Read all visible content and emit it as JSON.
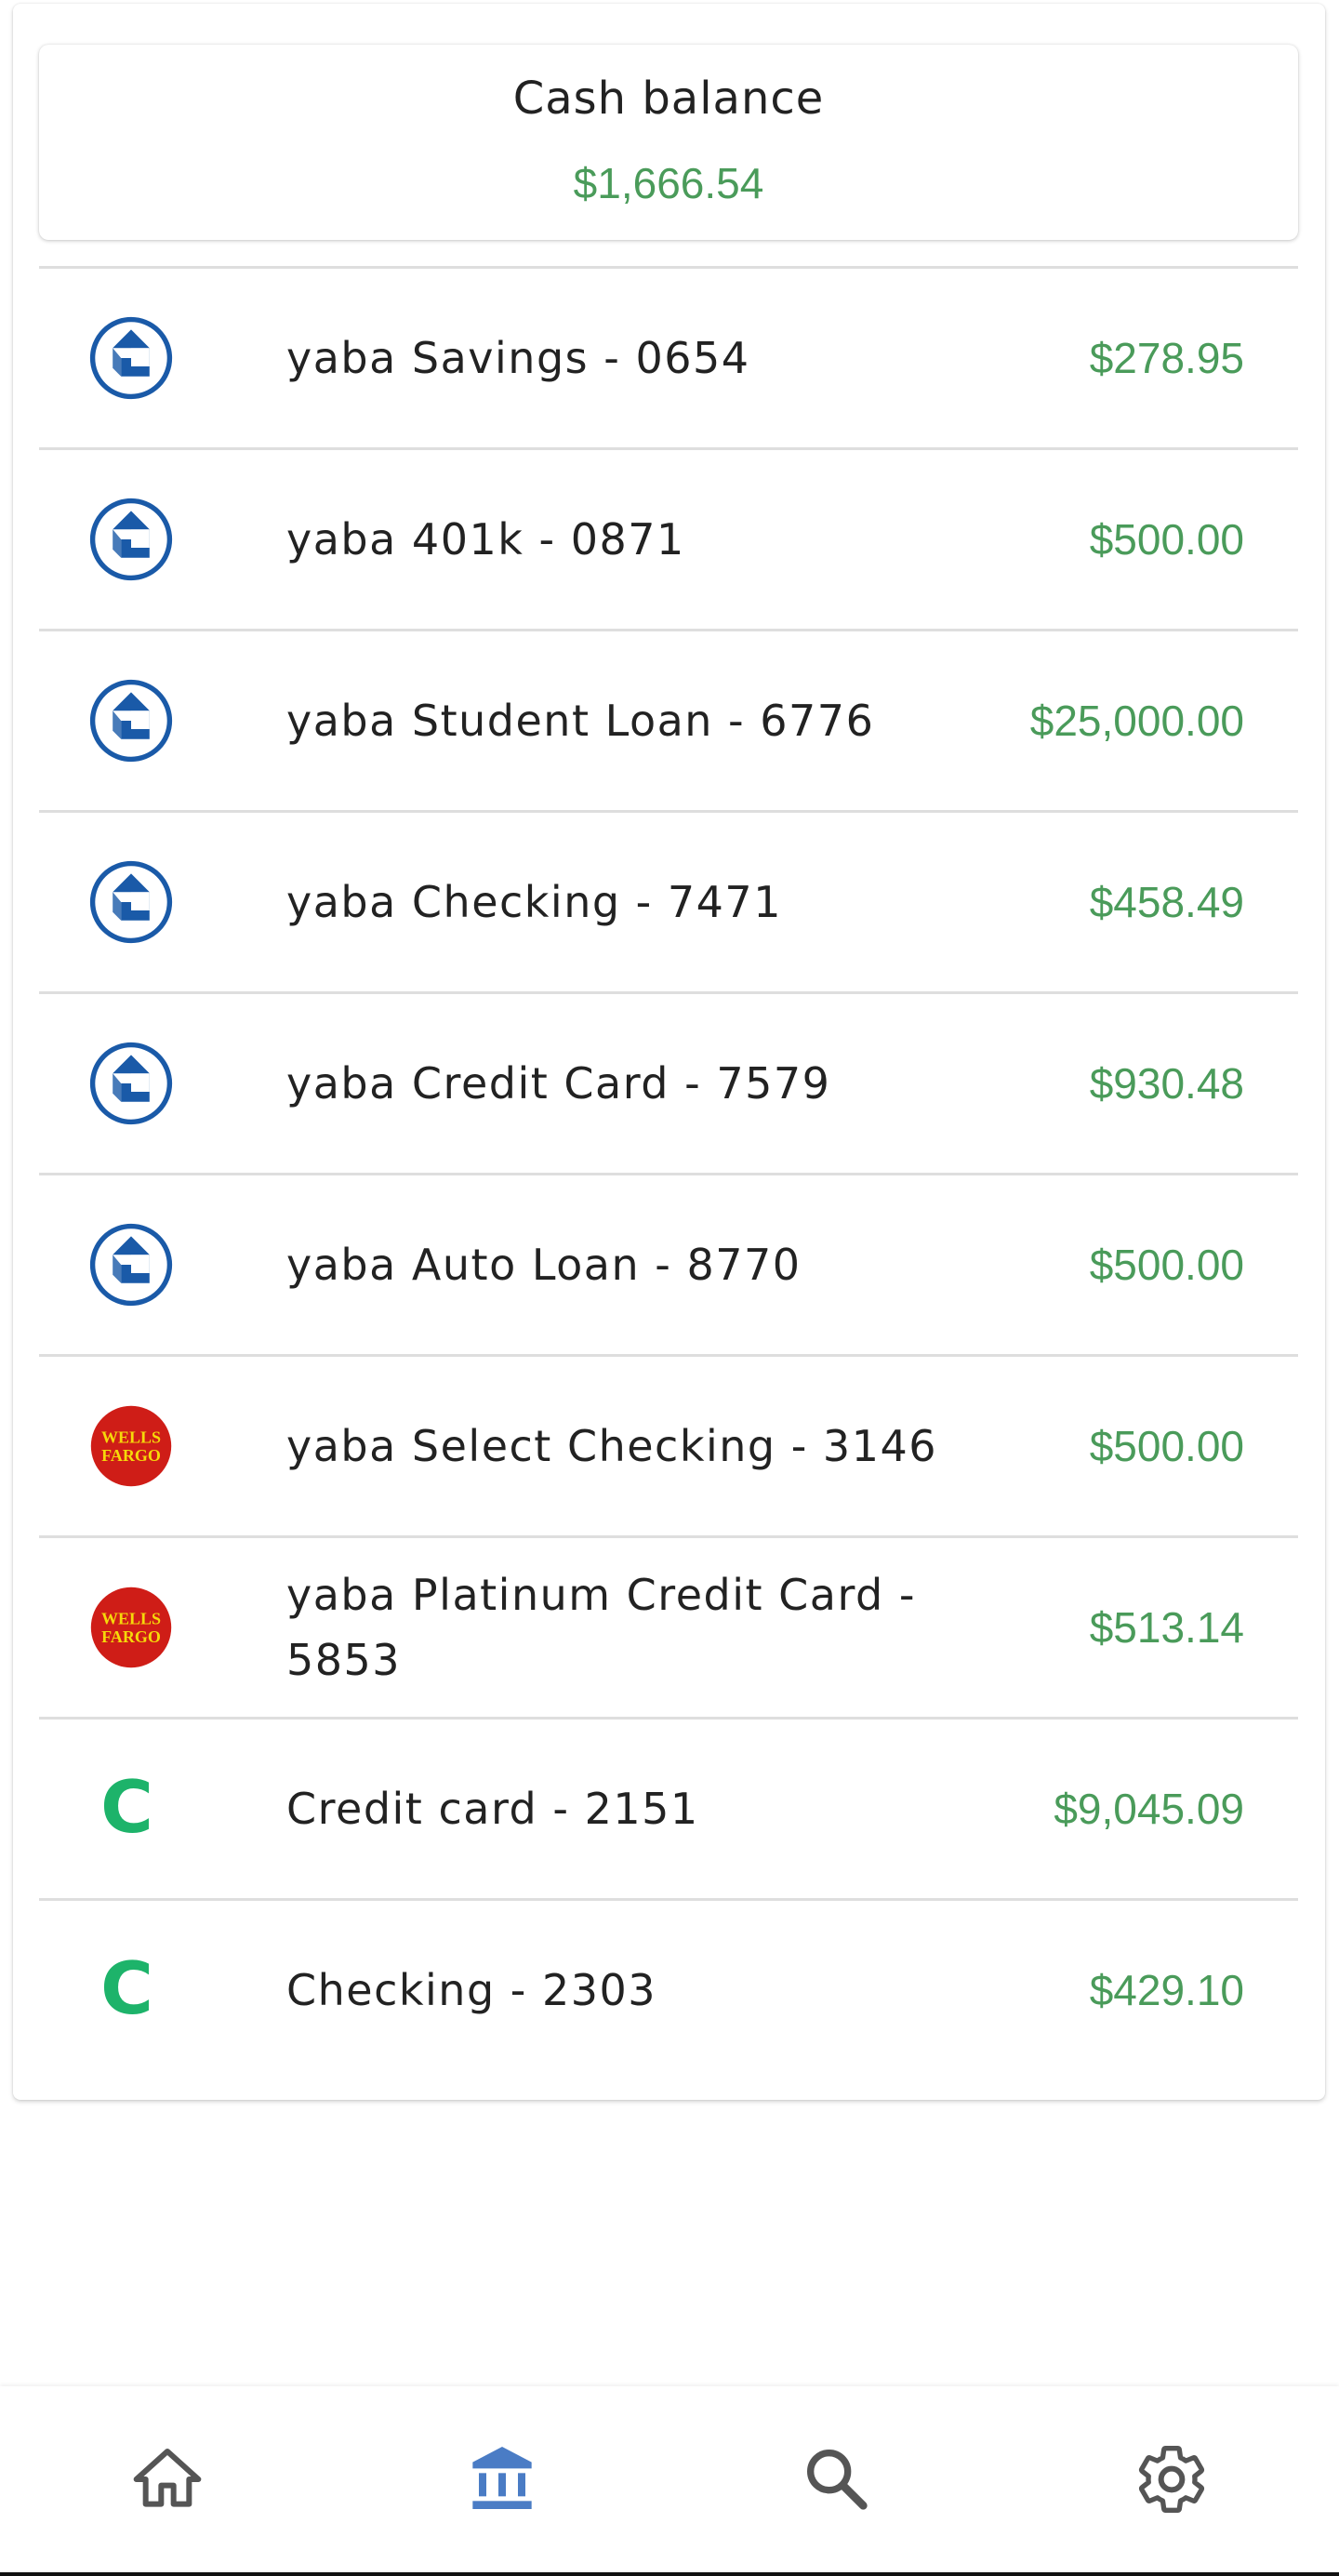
{
  "cash_balance": {
    "title": "Cash balance",
    "amount": "$1,666.54"
  },
  "accounts": [
    {
      "name": "yaba Savings - 0654",
      "balance": "$278.95",
      "icon": "chase-icon"
    },
    {
      "name": "yaba 401k - 0871",
      "balance": "$500.00",
      "icon": "chase-icon"
    },
    {
      "name": "yaba Student Loan - 6776",
      "balance": "$25,000.00",
      "icon": "chase-icon"
    },
    {
      "name": "yaba Checking - 7471",
      "balance": "$458.49",
      "icon": "chase-icon"
    },
    {
      "name": "yaba Credit Card - 7579",
      "balance": "$930.48",
      "icon": "chase-icon"
    },
    {
      "name": "yaba Auto Loan - 8770",
      "balance": "$500.00",
      "icon": "chase-icon"
    },
    {
      "name": "yaba Select Checking - 3146",
      "balance": "$500.00",
      "icon": "wells-fargo-icon"
    },
    {
      "name": "yaba Platinum Credit Card - 5853",
      "balance": "$513.14",
      "icon": "wells-fargo-icon"
    },
    {
      "name": "Credit card - 2151",
      "balance": "$9,045.09",
      "icon": "capital-c-icon"
    },
    {
      "name": "Checking - 2303",
      "balance": "$429.10",
      "icon": "capital-c-icon"
    }
  ],
  "wells_fargo_logo_text": [
    "WELLS",
    "FARGO"
  ],
  "capital_logo_letter": "C",
  "bottom_nav": {
    "items": [
      "home-icon",
      "bank-icon",
      "search-icon",
      "settings-icon"
    ],
    "active_index": 1
  },
  "colors": {
    "positive_amount": "#4a9b5a",
    "chase_blue": "#1a5aa8",
    "wells_red": "#cf1d17",
    "wells_yellow": "#f5d90a",
    "capital_green": "#1db36a",
    "nav_active": "#4a7cc5",
    "nav_inactive": "#555555"
  }
}
